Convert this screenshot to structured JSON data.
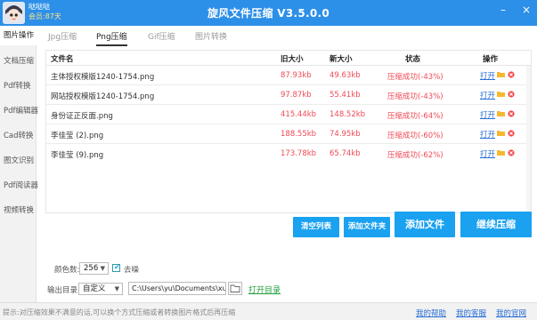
{
  "user": {
    "name": "哒哒哒",
    "member": "会员:87天"
  },
  "app_title": "旋风文件压缩 V3.5.0.0",
  "window_buttons": {
    "minimize": "–",
    "close": "×"
  },
  "sidebar": {
    "items": [
      {
        "label": "图片操作",
        "active": true
      },
      {
        "label": "文档压缩"
      },
      {
        "label": "Pdf转换"
      },
      {
        "label": "Pdf编辑器"
      },
      {
        "label": "Cad转换"
      },
      {
        "label": "图文识别"
      },
      {
        "label": "Pdf阅读器"
      },
      {
        "label": "视频转换"
      }
    ]
  },
  "tabs": [
    {
      "label": "Jpg压缩"
    },
    {
      "label": "Png压缩",
      "active": true
    },
    {
      "label": "Gif压缩"
    },
    {
      "label": "图片转换"
    }
  ],
  "table": {
    "headers": {
      "name": "文件名",
      "old_size": "旧大小",
      "new_size": "新大小",
      "status": "状态",
      "ops": "操作"
    },
    "rows": [
      {
        "name": "主体授权模版1240-1754.png",
        "old_size": "87.93kb",
        "new_size": "49.63kb",
        "status": "压缩成功(-43%)",
        "open": "打开"
      },
      {
        "name": "网站授权模版1240-1754.png",
        "old_size": "97.87kb",
        "new_size": "55.41kb",
        "status": "压缩成功(-43%)",
        "open": "打开"
      },
      {
        "name": "身份证正反面.png",
        "old_size": "415.44kb",
        "new_size": "148.52kb",
        "status": "压缩成功(-64%)",
        "open": "打开"
      },
      {
        "name": "李佳莹 (2).png",
        "old_size": "188.55kb",
        "new_size": "74.95kb",
        "status": "压缩成功(-60%)",
        "open": "打开"
      },
      {
        "name": "李佳莹 (9).png",
        "old_size": "173.78kb",
        "new_size": "65.74kb",
        "status": "压缩成功(-62%)",
        "open": "打开"
      }
    ]
  },
  "buttons": {
    "clear": "清空列表",
    "add_folder": "添加文件夹",
    "add_file": "添加文件",
    "continue": "继续压缩"
  },
  "options": {
    "color_label": "颜色数:",
    "color_value": "256",
    "dither_label": "去噪",
    "dither_checked": true,
    "output_label": "输出目录:",
    "output_mode": "自定义",
    "output_path": "C:\\Users\\yu\\Documents\\xuanfe",
    "open_dir": "打开目录"
  },
  "statusbar": {
    "tip": "提示:对压缩效果不满意的话,可以换个方式压缩或者转换图片格式后再压缩",
    "help": "我的帮助",
    "service": "我的客服",
    "website": "我的官网"
  },
  "colors": {
    "accent": "#1aa1f0",
    "titlebar": "#2c8fe8",
    "status_red": "#ef4a57",
    "link": "#2a6fd6",
    "open_dir": "#1e9e3a"
  }
}
